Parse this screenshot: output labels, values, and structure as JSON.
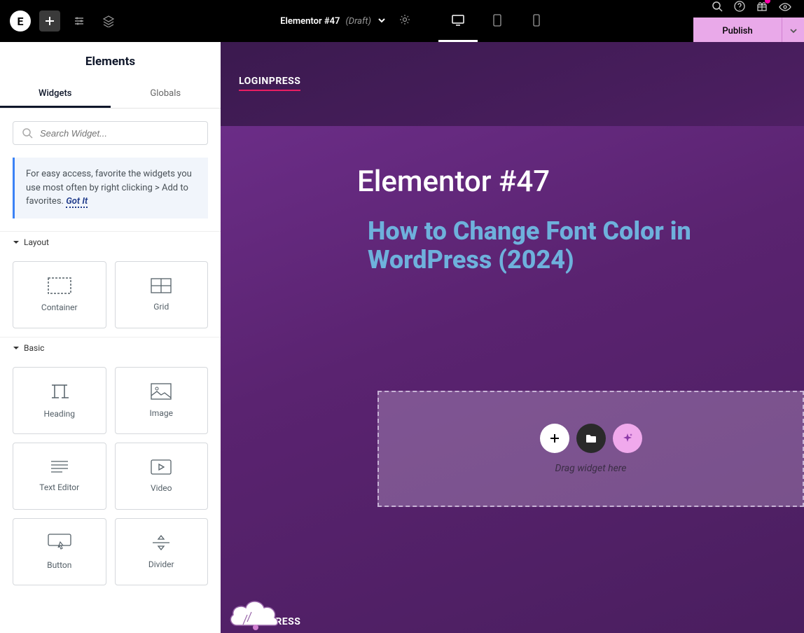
{
  "topbar": {
    "logo": "E",
    "page_title": "Elementor #47",
    "draft_label": "(Draft)",
    "publish_label": "Publish"
  },
  "sidebar": {
    "title": "Elements",
    "tabs": {
      "widgets": "Widgets",
      "globals": "Globals"
    },
    "search_placeholder": "Search Widget...",
    "hint_text": "For easy access, favorite the widgets you use most often by right clicking > Add to favorites.",
    "got_it": "Got It",
    "categories": {
      "layout": {
        "label": "Layout",
        "items": {
          "container": "Container",
          "grid": "Grid"
        }
      },
      "basic": {
        "label": "Basic",
        "items": {
          "heading": "Heading",
          "image": "Image",
          "text_editor": "Text Editor",
          "video": "Video",
          "button": "Button",
          "divider": "Divider"
        }
      }
    }
  },
  "canvas": {
    "brand": "LOGINPRESS",
    "title": "Elementor #47",
    "subtitle": "How to Change Font Color in WordPress (2024)",
    "drop_text": "Drag widget here",
    "brand_bottom": "LOGINPRESS"
  }
}
